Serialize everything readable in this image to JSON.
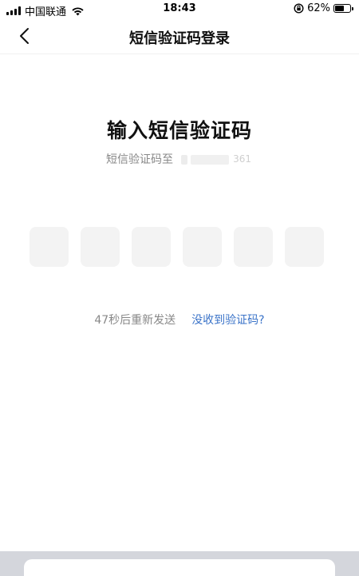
{
  "status_bar": {
    "carrier": "中国联通",
    "time": "18:43",
    "battery_percent": "62%",
    "battery_level": 0.62
  },
  "nav": {
    "title": "短信验证码登录"
  },
  "content": {
    "heading": "输入短信验证码",
    "sent_to_label": "短信验证码至",
    "phone_tail": "361",
    "code_boxes": [
      "",
      "",
      "",
      "",
      "",
      ""
    ],
    "resend_text": "47秒后重新发送",
    "help_link": "没收到验证码?"
  },
  "colors": {
    "link": "#3a73c8",
    "muted_text": "#888888",
    "code_box_bg": "#f3f3f3"
  },
  "icons": {
    "back": "chevron-left-icon",
    "wifi": "wifi-icon",
    "orientation_lock": "orientation-lock-icon",
    "battery": "battery-icon"
  }
}
